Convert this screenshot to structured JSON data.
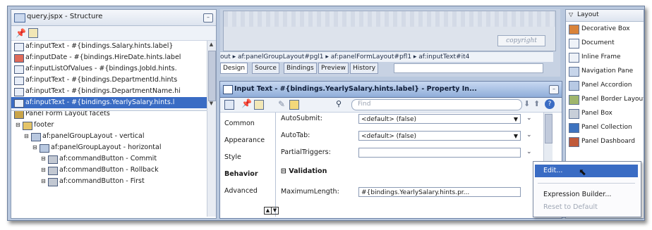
{
  "structure": {
    "title": "query.jspx - Structure",
    "rows": [
      {
        "icon": "input-text-icon",
        "text": "af:inputText - #{bindings.Salary.hints.label}",
        "indent": 0,
        "selected": false
      },
      {
        "icon": "input-date-icon",
        "text": "af:inputDate - #{bindings.HireDate.hints.label",
        "indent": 0,
        "selected": false
      },
      {
        "icon": "input-list-icon",
        "text": "af:inputListOfValues - #{bindings.JobId.hints.",
        "indent": 0,
        "selected": false
      },
      {
        "icon": "input-text-icon",
        "text": "af:inputText - #{bindings.DepartmentId.hints",
        "indent": 0,
        "selected": false
      },
      {
        "icon": "input-text-icon",
        "text": "af:inputText - #{bindings.DepartmentName.hi",
        "indent": 0,
        "selected": false
      },
      {
        "icon": "input-text-icon",
        "text": "af:inputText - #{bindings.YearlySalary.hints.l",
        "indent": 0,
        "selected": true
      },
      {
        "icon": "facets-icon",
        "text": "Panel Form Layout facets",
        "indent": 0,
        "selected": false
      },
      {
        "icon": "folder-icon",
        "text": "footer",
        "indent": 1,
        "selected": false
      },
      {
        "icon": "panel-group-icon",
        "text": "af:panelGroupLayout - vertical",
        "indent": 2,
        "selected": false
      },
      {
        "icon": "panel-group-icon",
        "text": "af:panelGroupLayout - horizontal",
        "indent": 3,
        "selected": false
      },
      {
        "icon": "command-button-icon",
        "text": "af:commandButton - Commit",
        "indent": 4,
        "selected": false
      },
      {
        "icon": "command-button-icon",
        "text": "af:commandButton - Rollback",
        "indent": 4,
        "selected": false
      },
      {
        "icon": "command-button-icon",
        "text": "af:commandButton - First",
        "indent": 4,
        "selected": false
      }
    ]
  },
  "editor": {
    "copyright_label": "copyright",
    "breadcrumb": "out ▸ af:panelGroupLayout#pgl1 ▸ af:panelFormLayout#pfl1 ▸ af:inputText#it4",
    "tabs": [
      "Design",
      "Source",
      "Bindings",
      "Preview",
      "History"
    ],
    "active_tab": "Design"
  },
  "property_inspector": {
    "title": "Input Text - #{bindings.YearlySalary.hints.label} - Property In...",
    "find_placeholder": "Find",
    "categories": [
      "Common",
      "Appearance",
      "Style",
      "Behavior",
      "Advanced"
    ],
    "active_category": "Behavior",
    "fields": [
      {
        "label": "AutoSubmit:",
        "value": "<default> (false)"
      },
      {
        "label": "AutoTab:",
        "value": "<default> (false)"
      },
      {
        "label": "PartialTriggers:",
        "value": ""
      }
    ],
    "section": "Validation",
    "validation_field": {
      "label": "MaximumLength:",
      "value": "#{bindings.YearlySalary.hints.pr..."
    }
  },
  "palette": {
    "header": "Layout",
    "items": [
      "Decorative Box",
      "Document",
      "Inline Frame",
      "Navigation Pane",
      "Panel Accordion",
      "Panel Border Layout",
      "Panel Box",
      "Panel Collection",
      "Panel Dashboard"
    ]
  },
  "context_menu": {
    "items": [
      {
        "label": "Edit...",
        "state": "highlighted"
      },
      {
        "label": "Expression Builder...",
        "state": "normal"
      },
      {
        "label": "Reset to Default",
        "state": "disabled"
      }
    ]
  },
  "colors": {
    "selection": "#3a6cc4",
    "frame_bg": "#b9c8de",
    "title_gradient_start": "#c8d8f1"
  }
}
